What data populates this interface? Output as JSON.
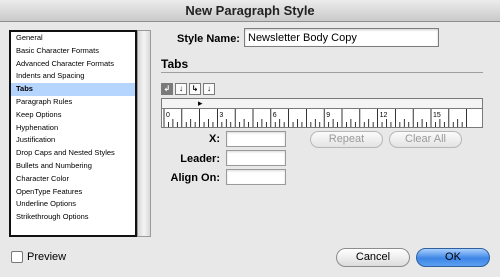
{
  "window": {
    "title": "New Paragraph Style"
  },
  "sidebar": {
    "items": [
      {
        "label": "General",
        "selected": false
      },
      {
        "label": "Basic Character Formats",
        "selected": false
      },
      {
        "label": "Advanced Character Formats",
        "selected": false
      },
      {
        "label": "Indents and Spacing",
        "selected": false
      },
      {
        "label": "Tabs",
        "selected": true
      },
      {
        "label": "Paragraph Rules",
        "selected": false
      },
      {
        "label": "Keep Options",
        "selected": false
      },
      {
        "label": "Hyphenation",
        "selected": false
      },
      {
        "label": "Justification",
        "selected": false
      },
      {
        "label": "Drop Caps and Nested Styles",
        "selected": false
      },
      {
        "label": "Bullets and Numbering",
        "selected": false
      },
      {
        "label": "Character Color",
        "selected": false
      },
      {
        "label": "OpenType Features",
        "selected": false
      },
      {
        "label": "Underline Options",
        "selected": false
      },
      {
        "label": "Strikethrough Options",
        "selected": false
      }
    ]
  },
  "style_name": {
    "label": "Style Name:",
    "value": "Newsletter Body Copy"
  },
  "tabs_section": {
    "title": "Tabs",
    "alignment_buttons": [
      {
        "icon": "left-tab-icon",
        "glyph": "↲",
        "active": true
      },
      {
        "icon": "center-tab-icon",
        "glyph": "↓",
        "active": false
      },
      {
        "icon": "right-tab-icon",
        "glyph": "↳",
        "active": false
      },
      {
        "icon": "decimal-tab-icon",
        "glyph": "↓",
        "active": false
      }
    ],
    "ruler_labels": [
      "0",
      "3",
      "6",
      "9",
      "12",
      "15"
    ],
    "x_label": "X:",
    "x_value": "",
    "leader_label": "Leader:",
    "leader_value": "",
    "align_on_label": "Align On:",
    "align_on_value": "",
    "repeat_label": "Repeat",
    "clear_all_label": "Clear All"
  },
  "footer": {
    "preview_label": "Preview",
    "preview_checked": false,
    "cancel_label": "Cancel",
    "ok_label": "OK"
  }
}
